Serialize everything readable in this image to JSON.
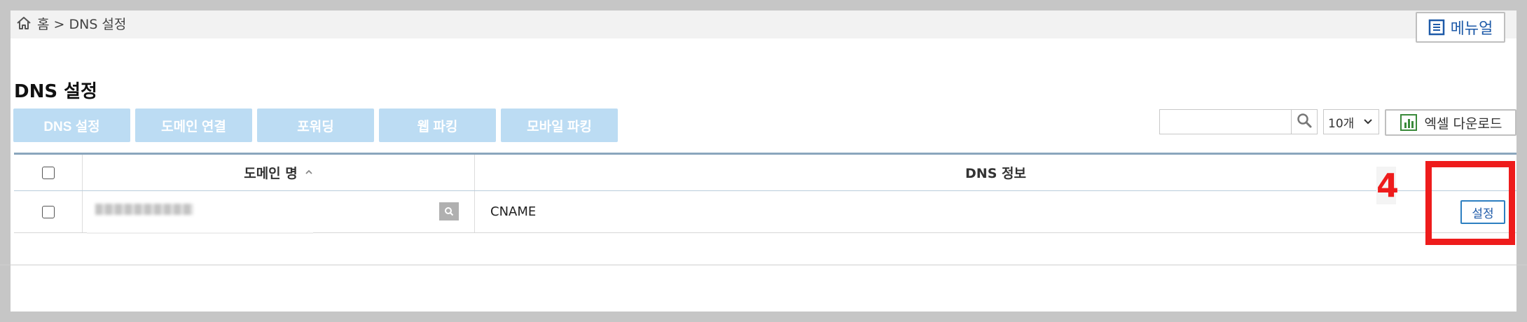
{
  "breadcrumb": {
    "home_icon": "home-icon",
    "text": "홈 > DNS 설정"
  },
  "manual_button": {
    "label": "메뉴얼",
    "icon": "document-list-icon"
  },
  "page_title": "DNS 설정",
  "tabs": [
    {
      "label": "DNS 설정"
    },
    {
      "label": "도메인 연결"
    },
    {
      "label": "포워딩"
    },
    {
      "label": "웹 파킹"
    },
    {
      "label": "모바일 파킹"
    }
  ],
  "toolbar": {
    "search_value": "",
    "search_icon": "search-icon",
    "page_size": "10개",
    "excel_label": "엑셀 다운로드",
    "excel_icon": "excel-chart-icon"
  },
  "table": {
    "headers": {
      "domain": "도메인 명",
      "dns": "DNS 정보"
    },
    "rows": [
      {
        "domain": "",
        "dns": "CNAME",
        "action": "설정"
      }
    ]
  },
  "annotation": {
    "number": "4",
    "color": "#ee1c1c"
  },
  "colors": {
    "tab_bg": "#bcdcf3",
    "accent_blue": "#1e5aa8",
    "table_border": "#8aa6bd"
  }
}
